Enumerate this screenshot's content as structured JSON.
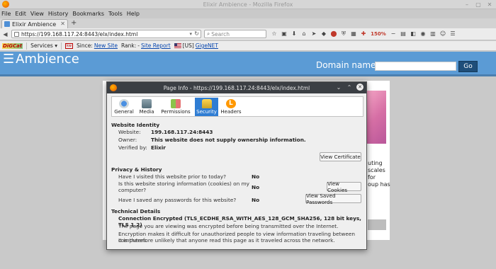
{
  "window": {
    "title": "Elixir Ambience - Mozilla Firefox"
  },
  "menu": [
    "File",
    "Edit",
    "View",
    "History",
    "Bookmarks",
    "Tools",
    "Help"
  ],
  "tab": {
    "title": "Elixir Ambience"
  },
  "nav": {
    "url": "https://199.168.117.24:8443/elx/index.html",
    "search_placeholder": "Search",
    "zoom": "150%"
  },
  "bookmarks": {
    "services": "Services",
    "since_label": "Since:",
    "new_site": "New Site",
    "rank_label": "Rank:",
    "site_report": "Site Report",
    "country": "[US]",
    "host": "GigeNET"
  },
  "site": {
    "title": "Ambience",
    "domain_label": "Domain name:",
    "go_label": "Go",
    "side_text": [
      "uting",
      "scales",
      "for",
      "oup has"
    ]
  },
  "dialog": {
    "title": "Page Info - https://199.168.117.24:8443/elx/index.html",
    "tabs": [
      "General",
      "Media",
      "Permissions",
      "Security",
      "Headers"
    ],
    "active_tab": "Security",
    "identity": {
      "heading": "Website Identity",
      "website_label": "Website:",
      "website_value": "199.168.117.24:8443",
      "owner_label": "Owner:",
      "owner_value": "This website does not supply ownership information.",
      "verified_label": "Verified by:",
      "verified_value": "Elixir",
      "view_cert": "View Certificate"
    },
    "privacy": {
      "heading": "Privacy & History",
      "q1": "Have I visited this website prior to today?",
      "a1": "No",
      "q2a": "Is this website storing information (cookies) on my",
      "q2b": "computer?",
      "a2": "No",
      "view_cookies": "View Cookies",
      "q3": "Have I saved any passwords for this website?",
      "a3": "No",
      "view_passwords": "View Saved Passwords"
    },
    "technical": {
      "heading": "Technical Details",
      "connection": "Connection Encrypted (TLS_ECDHE_RSA_WITH_AES_128_GCM_SHA256, 128 bit keys, TLS 1.2)",
      "line1": "The page you are viewing was encrypted before being transmitted over the Internet.",
      "line2": "Encryption makes it difficult for unauthorized people to view information traveling between computers.",
      "line3": "It is therefore unlikely that anyone read this page as it traveled across the network."
    }
  },
  "colors": {
    "header": "#5b9bd5",
    "go_button": "#1f4e79",
    "active_tab": "#2f7dd3"
  }
}
